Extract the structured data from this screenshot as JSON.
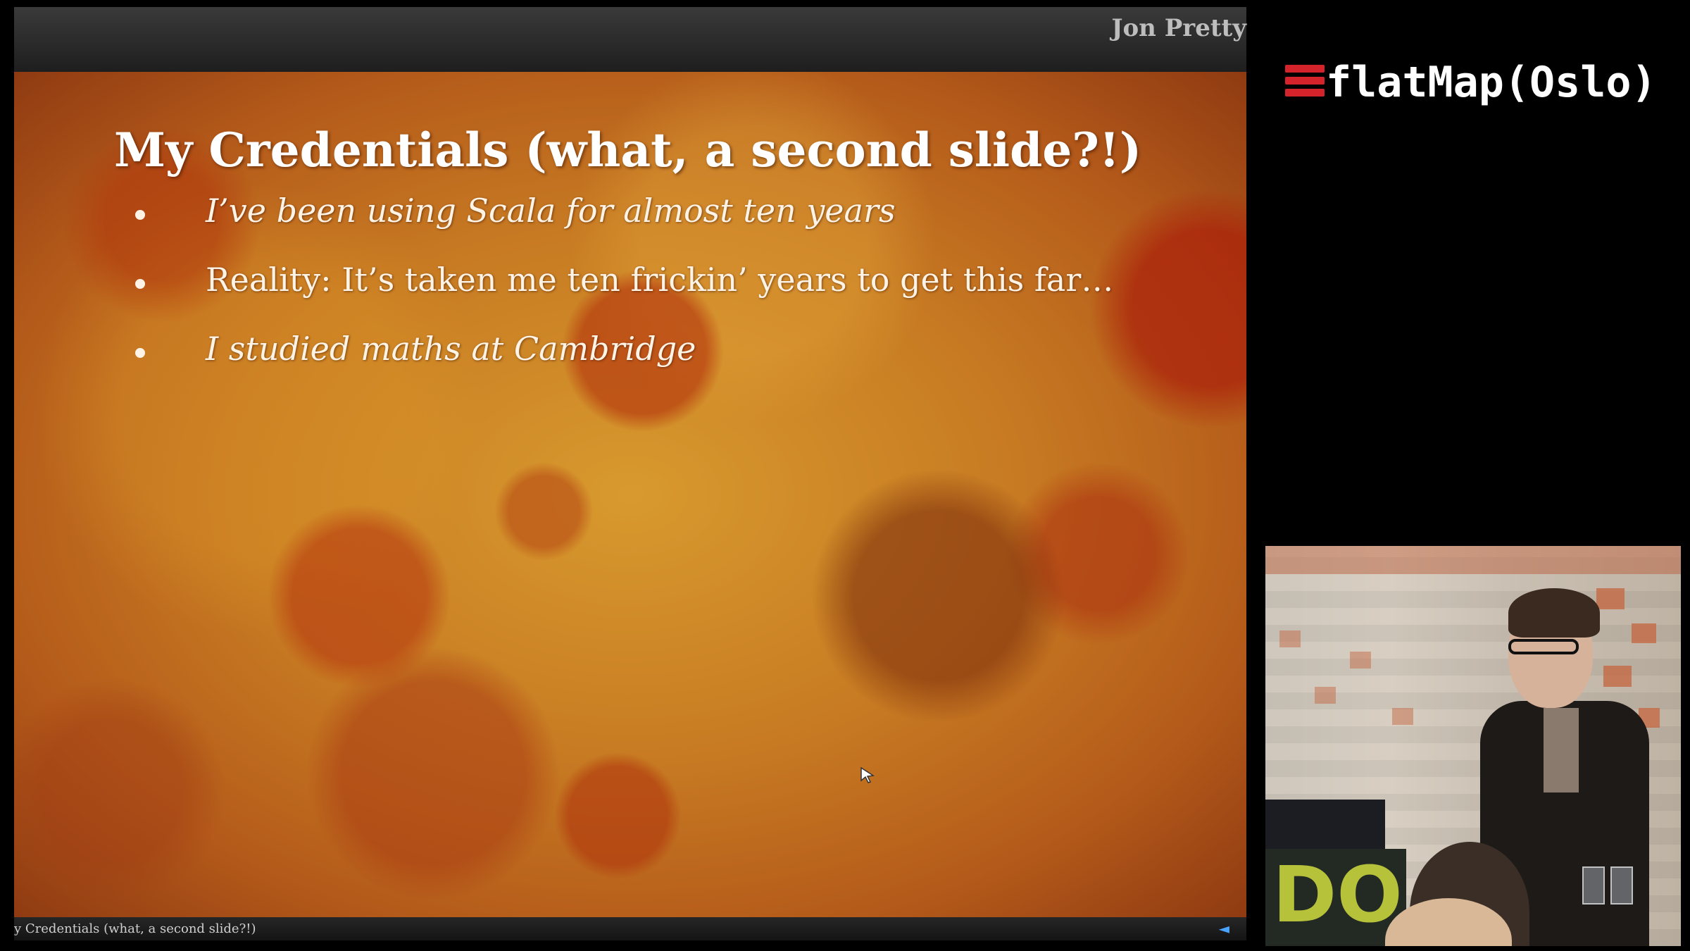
{
  "slide": {
    "author": "Jon Pretty",
    "title": "My Credentials (what, a second slide?!)",
    "bullets": [
      {
        "text": "I’ve been using Scala for almost ten years",
        "italic": true
      },
      {
        "text": "Reality: It’s taken me ten frickin’ years to get this far…",
        "italic": false
      },
      {
        "text": "I studied maths at Cambridge",
        "italic": true
      }
    ],
    "footer_title": "y Credentials (what, a second slide?!)",
    "footer_nav_icon": "◄"
  },
  "brand": {
    "icon": "menu-bars-icon",
    "text": "flatMap(Oslo)",
    "accent_color": "#d4232b"
  },
  "video": {
    "podium_logo": "DO"
  }
}
